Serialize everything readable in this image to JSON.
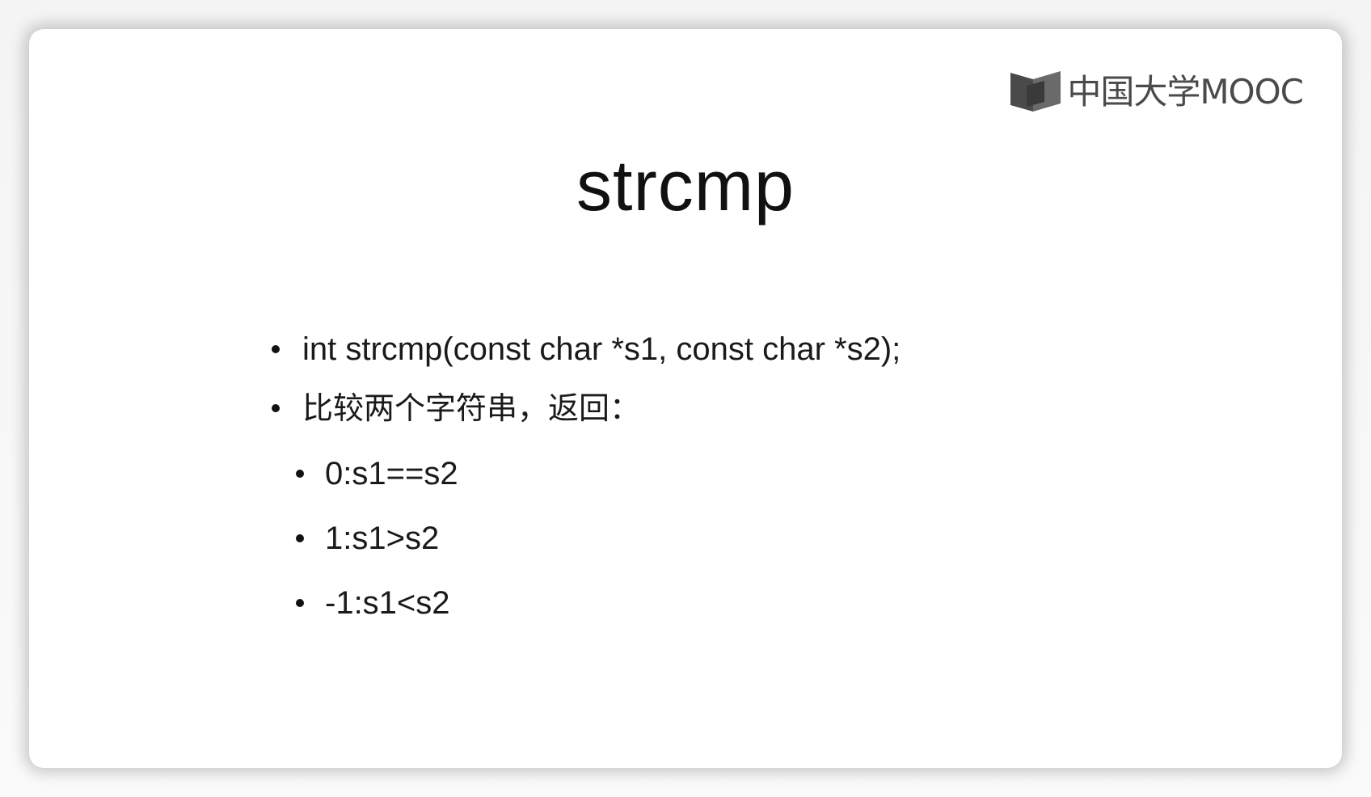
{
  "logo": {
    "text": "中国大学MOOC",
    "icon": "book-icon",
    "color": "#4a4a4a"
  },
  "title": "strcmp",
  "bullets": [
    {
      "text": "int strcmp(const char *s1, const char *s2);"
    },
    {
      "text": "比较两个字符串，返回："
    }
  ],
  "sub_bullets": [
    {
      "text": "0:s1==s2"
    },
    {
      "text": "1:s1>s2"
    },
    {
      "text": "-1:s1<s2"
    }
  ]
}
